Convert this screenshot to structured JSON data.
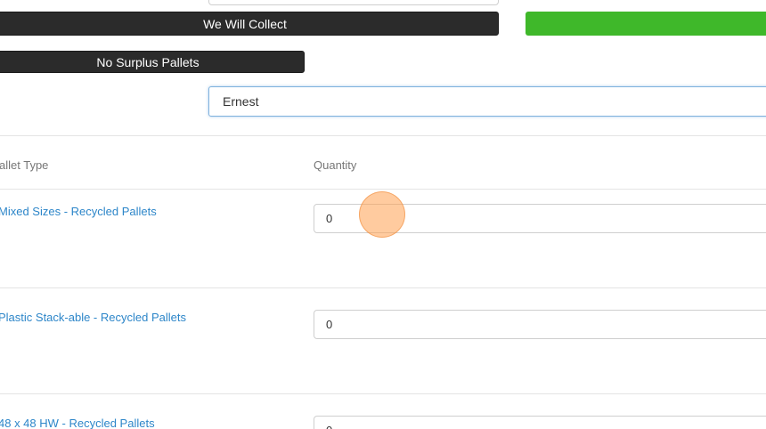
{
  "collection": {
    "we_will_collect_label": "We Will Collect",
    "no_surplus_label": "No Surplus Pallets"
  },
  "name_field": {
    "value": "Ernest"
  },
  "table": {
    "columns": [
      "allet Type",
      "Quantity"
    ],
    "rows": [
      {
        "pallet_type": "Mixed Sizes - Recycled Pallets",
        "quantity": "0"
      },
      {
        "pallet_type": "Plastic Stack-able - Recycled Pallets",
        "quantity": "0"
      },
      {
        "pallet_type": "48 x 48 HW - Recycled Pallets",
        "quantity": "0"
      }
    ]
  },
  "colors": {
    "dark_button": "#2b2b2b",
    "green_button": "#3fb82a",
    "link": "#2d86c9"
  }
}
